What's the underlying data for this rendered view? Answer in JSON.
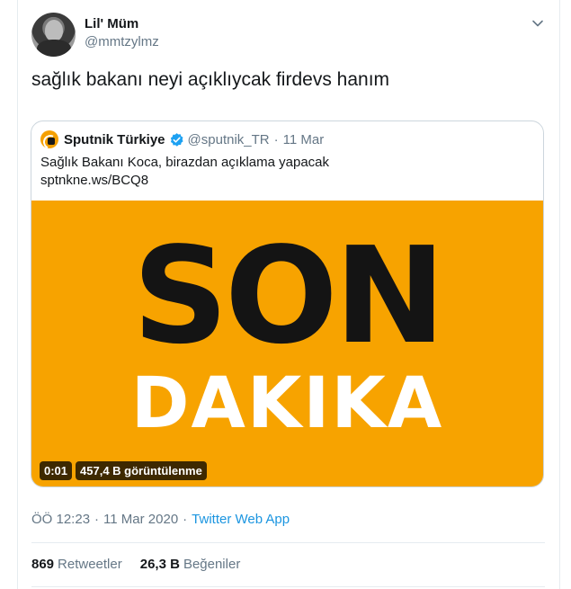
{
  "tweet": {
    "display_name": "Lil' Müm",
    "handle": "@mmtzylmz",
    "text": "sağlık bakanı neyi açıklıycak firdevs hanım"
  },
  "quoted": {
    "name": "Sputnik Türkiye",
    "handle": "@sputnik_TR",
    "separator": "·",
    "date": "11 Mar",
    "text_line1": "Sağlık Bakanı Koca, birazdan açıklama yapacak",
    "text_line2": "sptnkne.ws/BCQ8",
    "media": {
      "headline": "SON",
      "subheadline": "DAKIKA",
      "duration": "0:01",
      "views": "457,4 B görüntülenme"
    }
  },
  "meta": {
    "time": "ÖÖ 12:23",
    "separator": "·",
    "date": "11 Mar 2020",
    "separator2": "·",
    "app": "Twitter Web App"
  },
  "stats": {
    "retweets_count": "869",
    "retweets_label": "Retweetler",
    "likes_count": "26,3 B",
    "likes_label": "Beğeniler"
  },
  "icons": {
    "caret": "chevron-down-icon",
    "verified": "verified-badge-icon"
  },
  "colors": {
    "accent": "#1b95e0",
    "media_bg": "#f7a300",
    "muted": "#657786"
  }
}
